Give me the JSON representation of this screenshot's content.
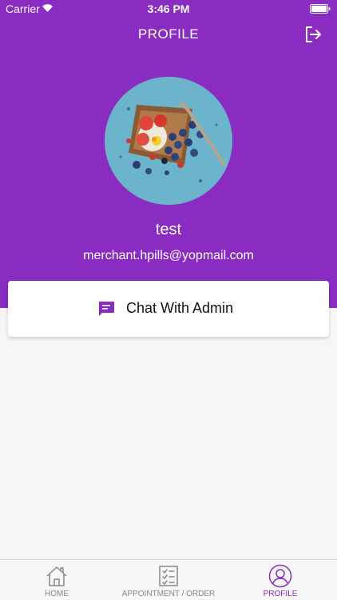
{
  "status_bar": {
    "carrier": "Carrier",
    "time": "3:46 PM"
  },
  "header": {
    "title": "PROFILE",
    "background_color": "#8a2bc2",
    "logout_icon": "logout-icon"
  },
  "profile": {
    "name": "test",
    "email": "merchant.hpills@yopmail.com",
    "avatar_icon": "food-photo-avatar"
  },
  "chat_card": {
    "label": "Chat With Admin",
    "icon": "chat-bubble-icon",
    "icon_color": "#8a2bc2"
  },
  "tab_bar": {
    "items": [
      {
        "label": "HOME",
        "icon": "home-icon",
        "active": false
      },
      {
        "label": "APPOINTMENT / ORDER",
        "icon": "checklist-icon",
        "active": false
      },
      {
        "label": "PROFILE",
        "icon": "user-circle-icon",
        "active": true
      }
    ],
    "active_color": "#8a2bc2",
    "inactive_color": "#888888"
  }
}
